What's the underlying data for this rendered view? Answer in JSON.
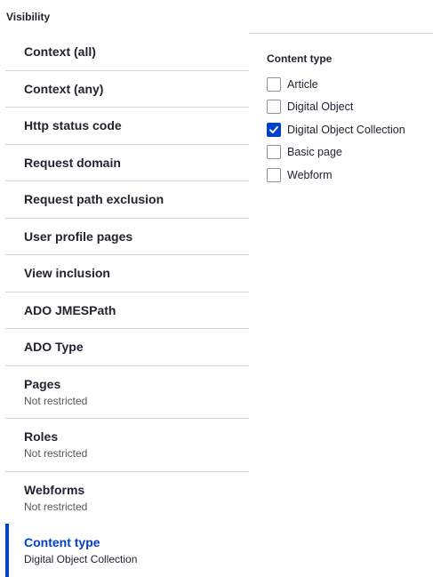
{
  "section": {
    "title": "Visibility"
  },
  "tabs": [
    {
      "label": "Context (all)"
    },
    {
      "label": "Context (any)"
    },
    {
      "label": "Http status code"
    },
    {
      "label": "Request domain"
    },
    {
      "label": "Request path exclusion"
    },
    {
      "label": "User profile pages"
    },
    {
      "label": "View inclusion"
    },
    {
      "label": "ADO JMESPath"
    },
    {
      "label": "ADO Type"
    },
    {
      "label": "Pages",
      "summary": "Not restricted"
    },
    {
      "label": "Roles",
      "summary": "Not restricted"
    },
    {
      "label": "Webforms",
      "summary": "Not restricted"
    },
    {
      "label": "Content type",
      "summary": "Digital Object Collection",
      "active": true
    }
  ],
  "pane": {
    "title": "Content type",
    "options": [
      {
        "label": "Article",
        "checked": false
      },
      {
        "label": "Digital Object",
        "checked": false
      },
      {
        "label": "Digital Object Collection",
        "checked": true
      },
      {
        "label": "Basic page",
        "checked": false
      },
      {
        "label": "Webform",
        "checked": false
      }
    ]
  },
  "colors": {
    "accent": "#003ecc",
    "text": "#222330",
    "muted": "#55565b",
    "border": "#d3d4d9"
  },
  "icons": {
    "checkmark": "check-icon"
  }
}
